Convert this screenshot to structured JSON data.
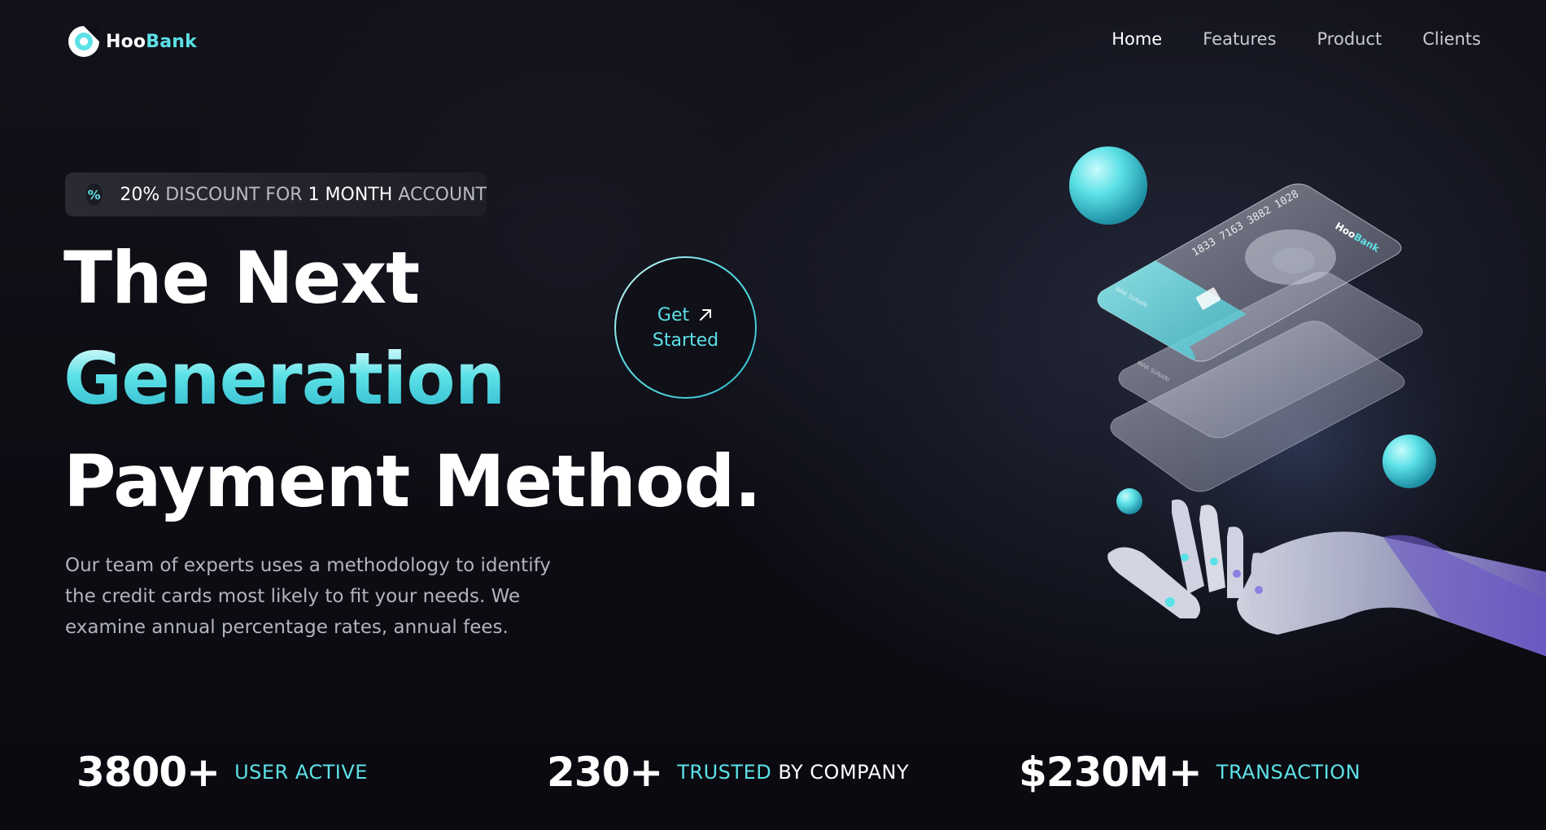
{
  "brand": {
    "name_part1": "Hoo",
    "name_part2": "Bank"
  },
  "nav": {
    "items": [
      {
        "label": "Home",
        "active": true
      },
      {
        "label": "Features"
      },
      {
        "label": "Product"
      },
      {
        "label": "Clients"
      }
    ]
  },
  "badge": {
    "icon": "percent-icon",
    "percent": "20%",
    "text_mid": " DISCOUNT FOR ",
    "duration": "1 MONTH",
    "text_end": " ACCOUNT"
  },
  "hero": {
    "line1": "The Next",
    "line2": "Generation",
    "line3": "Payment Method.",
    "description": "Our team of experts uses a methodology to identify the credit cards most likely to fit your needs. We examine annual percentage rates, annual fees."
  },
  "cta": {
    "line1": "Get",
    "line2": "Started",
    "icon": "arrow-up-right-icon"
  },
  "stats": [
    {
      "value": "3800+",
      "label": "USER ACTIVE"
    },
    {
      "value": "230+",
      "label_accent": "TRUSTED",
      "label_rest": " BY COMPANY"
    },
    {
      "value": "$230M+",
      "label": "TRANSACTION"
    }
  ],
  "illustration": {
    "card_number": "1833 7163 3882 1028",
    "card_holder": "WAK SUNARI",
    "card_brand_part1": "Hoo",
    "card_brand_part2": "Bank"
  },
  "colors": {
    "accent": "#5ce1e6",
    "background": "#0b0b11",
    "text_muted": "#b2b3bf"
  }
}
